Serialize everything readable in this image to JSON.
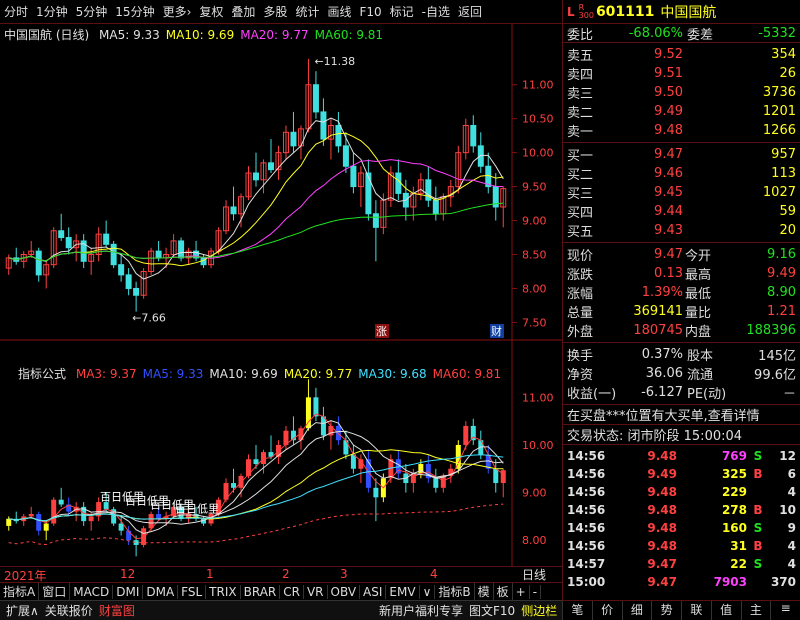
{
  "toolbar": [
    "分时",
    "1分钟",
    "5分钟",
    "15分钟",
    "更多›",
    "复权",
    "叠加",
    "多股",
    "统计",
    "画线",
    "F10",
    "标记",
    "-自选",
    "返回"
  ],
  "main_panel": {
    "title": "中国国航 (日线)",
    "ma": [
      {
        "label": "MA5: 9.33",
        "color": "#e0e0e0"
      },
      {
        "label": "MA10: 9.69",
        "color": "#ffff20"
      },
      {
        "label": "MA20: 9.77",
        "color": "#ff40ff"
      },
      {
        "label": "MA60: 9.81",
        "color": "#20e020"
      }
    ],
    "yticks": [
      "11.00",
      "10.50",
      "10.00",
      "9.50",
      "9.00",
      "8.50",
      "8.00",
      "7.50"
    ],
    "high_label": "11.38",
    "low_label": "7.66",
    "tag_zhang": "涨",
    "tag_cai": "财"
  },
  "sub_panel": {
    "title": "指标公式",
    "ma": [
      {
        "label": "MA3: 9.37",
        "color": "#ff4040"
      },
      {
        "label": "MA5: 9.33",
        "color": "#3050ff"
      },
      {
        "label": "MA10: 9.69",
        "color": "#e0e0e0"
      },
      {
        "label": "MA20: 9.77",
        "color": "#ffff20"
      },
      {
        "label": "MA30: 9.68",
        "color": "#40e0ff"
      },
      {
        "label": "MA60: 9.81",
        "color": "#ff4040"
      }
    ],
    "yticks": [
      "11.00",
      "10.00",
      "9.00",
      "8.00"
    ],
    "annotations": [
      "百日低里",
      "百日低里",
      "百日低里",
      "百日低里"
    ]
  },
  "xaxis": {
    "labels": [
      "2021年",
      "12",
      "1",
      "2",
      "3",
      "4"
    ],
    "right_label": "日线"
  },
  "bottom_tabs": [
    "指标A",
    "窗口",
    "MACD",
    "DMI",
    "DMA",
    "FSL",
    "TRIX",
    "BRAR",
    "CR",
    "VR",
    "OBV",
    "ASI",
    "EMV",
    "∨",
    "指标B",
    "模",
    "板",
    "+",
    "-"
  ],
  "status_bar": {
    "left": [
      "扩展∧",
      "关联报价",
      "财富图"
    ],
    "right": [
      "新用户福利专享",
      "图文F10",
      "侧边栏《"
    ]
  },
  "quote": {
    "badge_l": "L",
    "badge_r": "R",
    "badge_num": "300",
    "code": "601111",
    "name": "中国国航",
    "weibi_label": "委比",
    "weibi": "-68.06%",
    "weicha_label": "委差",
    "weicha": "-5332",
    "sell": [
      {
        "label": "卖五",
        "price": "9.52",
        "vol": "354"
      },
      {
        "label": "卖四",
        "price": "9.51",
        "vol": "26"
      },
      {
        "label": "卖三",
        "price": "9.50",
        "vol": "3736"
      },
      {
        "label": "卖二",
        "price": "9.49",
        "vol": "1201"
      },
      {
        "label": "卖一",
        "price": "9.48",
        "vol": "1266"
      }
    ],
    "buy": [
      {
        "label": "买一",
        "price": "9.47",
        "vol": "957"
      },
      {
        "label": "买二",
        "price": "9.46",
        "vol": "113"
      },
      {
        "label": "买三",
        "price": "9.45",
        "vol": "1027"
      },
      {
        "label": "买四",
        "price": "9.44",
        "vol": "59"
      },
      {
        "label": "买五",
        "price": "9.43",
        "vol": "20"
      }
    ],
    "stats": [
      {
        "l1": "现价",
        "v1": "9.47",
        "c1": "red",
        "l2": "今开",
        "v2": "9.16",
        "c2": "grn"
      },
      {
        "l1": "涨跌",
        "v1": "0.13",
        "c1": "red",
        "l2": "最高",
        "v2": "9.49",
        "c2": "red"
      },
      {
        "l1": "涨幅",
        "v1": "1.39%",
        "c1": "red",
        "l2": "最低",
        "v2": "8.90",
        "c2": "grn"
      },
      {
        "l1": "总量",
        "v1": "369141",
        "c1": "yel",
        "l2": "量比",
        "v2": "1.21",
        "c2": "red"
      },
      {
        "l1": "外盘",
        "v1": "180745",
        "c1": "red",
        "l2": "内盘",
        "v2": "188396",
        "c2": "grn"
      }
    ],
    "stats2": [
      {
        "l1": "换手",
        "v1": "0.37%",
        "l2": "股本",
        "v2": "145亿"
      },
      {
        "l1": "净资",
        "v1": "36.06",
        "l2": "流通",
        "v2": "99.6亿"
      },
      {
        "l1": "收益(一)",
        "v1": "-6.127",
        "l2": "PE(动)",
        "v2": "－"
      }
    ],
    "notice": "在买盘***位置有大买单,查看详情",
    "trade_status": "交易状态: 闭市阶段 15:00:04",
    "ticks": [
      {
        "time": "14:56",
        "price": "9.48",
        "vol": "769",
        "vc": "mag",
        "side": "S",
        "count": "12"
      },
      {
        "time": "14:56",
        "price": "9.49",
        "vol": "325",
        "vc": "yel",
        "side": "B",
        "count": "6"
      },
      {
        "time": "14:56",
        "price": "9.48",
        "vol": "229",
        "vc": "yel",
        "side": "",
        "count": "4"
      },
      {
        "time": "14:56",
        "price": "9.48",
        "vol": "278",
        "vc": "yel",
        "side": "B",
        "count": "10"
      },
      {
        "time": "14:56",
        "price": "9.48",
        "vol": "160",
        "vc": "yel",
        "side": "S",
        "count": "9"
      },
      {
        "time": "14:56",
        "price": "9.48",
        "vol": "31",
        "vc": "yel",
        "side": "B",
        "count": "4"
      },
      {
        "time": "14:57",
        "price": "9.47",
        "vol": "22",
        "vc": "yel",
        "side": "S",
        "count": "4"
      },
      {
        "time": "15:00",
        "price": "9.47",
        "vol": "7903",
        "vc": "mag",
        "side": "",
        "count": "370"
      }
    ],
    "right_tabs": [
      "笔",
      "价",
      "细",
      "势",
      "联",
      "值",
      "主",
      "≡"
    ]
  },
  "chart_data": {
    "type": "candlestick",
    "ylim": [
      7.3,
      11.6
    ],
    "candles": [
      [
        8.3,
        8.5,
        8.2,
        8.45
      ],
      [
        8.45,
        8.6,
        8.35,
        8.4
      ],
      [
        8.4,
        8.55,
        8.3,
        8.5
      ],
      [
        8.5,
        8.7,
        8.45,
        8.55
      ],
      [
        8.55,
        8.6,
        8.1,
        8.2
      ],
      [
        8.2,
        8.4,
        8.0,
        8.35
      ],
      [
        8.35,
        8.9,
        8.3,
        8.85
      ],
      [
        8.85,
        9.1,
        8.7,
        8.75
      ],
      [
        8.75,
        8.9,
        8.5,
        8.6
      ],
      [
        8.6,
        8.8,
        8.4,
        8.7
      ],
      [
        8.7,
        8.8,
        8.3,
        8.4
      ],
      [
        8.4,
        8.6,
        8.2,
        8.5
      ],
      [
        8.5,
        8.9,
        8.4,
        8.8
      ],
      [
        8.8,
        9.0,
        8.6,
        8.65
      ],
      [
        8.65,
        8.7,
        8.3,
        8.35
      ],
      [
        8.35,
        8.5,
        8.1,
        8.2
      ],
      [
        8.2,
        8.3,
        7.9,
        8.0
      ],
      [
        8.0,
        8.1,
        7.66,
        7.9
      ],
      [
        7.9,
        8.3,
        7.85,
        8.25
      ],
      [
        8.25,
        8.6,
        8.2,
        8.55
      ],
      [
        8.55,
        8.7,
        8.4,
        8.45
      ],
      [
        8.45,
        8.6,
        8.3,
        8.5
      ],
      [
        8.5,
        8.8,
        8.45,
        8.7
      ],
      [
        8.7,
        8.75,
        8.4,
        8.45
      ],
      [
        8.45,
        8.6,
        8.35,
        8.55
      ],
      [
        8.55,
        8.7,
        8.4,
        8.45
      ],
      [
        8.45,
        8.5,
        8.3,
        8.35
      ],
      [
        8.35,
        8.6,
        8.3,
        8.55
      ],
      [
        8.55,
        8.9,
        8.5,
        8.85
      ],
      [
        8.85,
        9.3,
        8.8,
        9.2
      ],
      [
        9.2,
        9.5,
        9.0,
        9.1
      ],
      [
        9.1,
        9.4,
        8.9,
        9.35
      ],
      [
        9.35,
        9.8,
        9.3,
        9.7
      ],
      [
        9.7,
        10.0,
        9.5,
        9.6
      ],
      [
        9.6,
        9.9,
        9.4,
        9.85
      ],
      [
        9.85,
        10.2,
        9.7,
        9.75
      ],
      [
        9.75,
        10.1,
        9.6,
        10.0
      ],
      [
        10.0,
        10.4,
        9.9,
        10.3
      ],
      [
        10.3,
        10.6,
        10.0,
        10.1
      ],
      [
        10.1,
        10.4,
        9.9,
        10.35
      ],
      [
        10.35,
        11.38,
        10.3,
        11.0
      ],
      [
        11.0,
        11.2,
        10.5,
        10.6
      ],
      [
        10.6,
        10.8,
        10.1,
        10.2
      ],
      [
        10.2,
        10.5,
        9.9,
        10.4
      ],
      [
        10.4,
        10.6,
        10.0,
        10.1
      ],
      [
        10.1,
        10.3,
        9.7,
        9.8
      ],
      [
        9.8,
        10.0,
        9.4,
        9.5
      ],
      [
        9.5,
        9.8,
        9.2,
        9.7
      ],
      [
        9.7,
        9.9,
        9.0,
        9.1
      ],
      [
        9.1,
        9.3,
        8.4,
        8.9
      ],
      [
        8.9,
        9.4,
        8.8,
        9.3
      ],
      [
        9.3,
        9.8,
        9.2,
        9.7
      ],
      [
        9.7,
        9.9,
        9.3,
        9.4
      ],
      [
        9.4,
        9.6,
        9.0,
        9.2
      ],
      [
        9.2,
        9.5,
        9.0,
        9.4
      ],
      [
        9.4,
        9.7,
        9.3,
        9.6
      ],
      [
        9.6,
        9.8,
        9.2,
        9.3
      ],
      [
        9.3,
        9.5,
        9.0,
        9.1
      ],
      [
        9.1,
        9.4,
        9.0,
        9.35
      ],
      [
        9.35,
        9.6,
        9.2,
        9.5
      ],
      [
        9.5,
        10.1,
        9.4,
        10.0
      ],
      [
        10.0,
        10.5,
        9.9,
        10.4
      ],
      [
        10.4,
        10.55,
        10.0,
        10.1
      ],
      [
        10.1,
        10.3,
        9.7,
        9.8
      ],
      [
        9.8,
        10.0,
        9.4,
        9.5
      ],
      [
        9.5,
        9.7,
        9.0,
        9.2
      ],
      [
        9.2,
        9.5,
        8.9,
        9.47
      ]
    ]
  }
}
